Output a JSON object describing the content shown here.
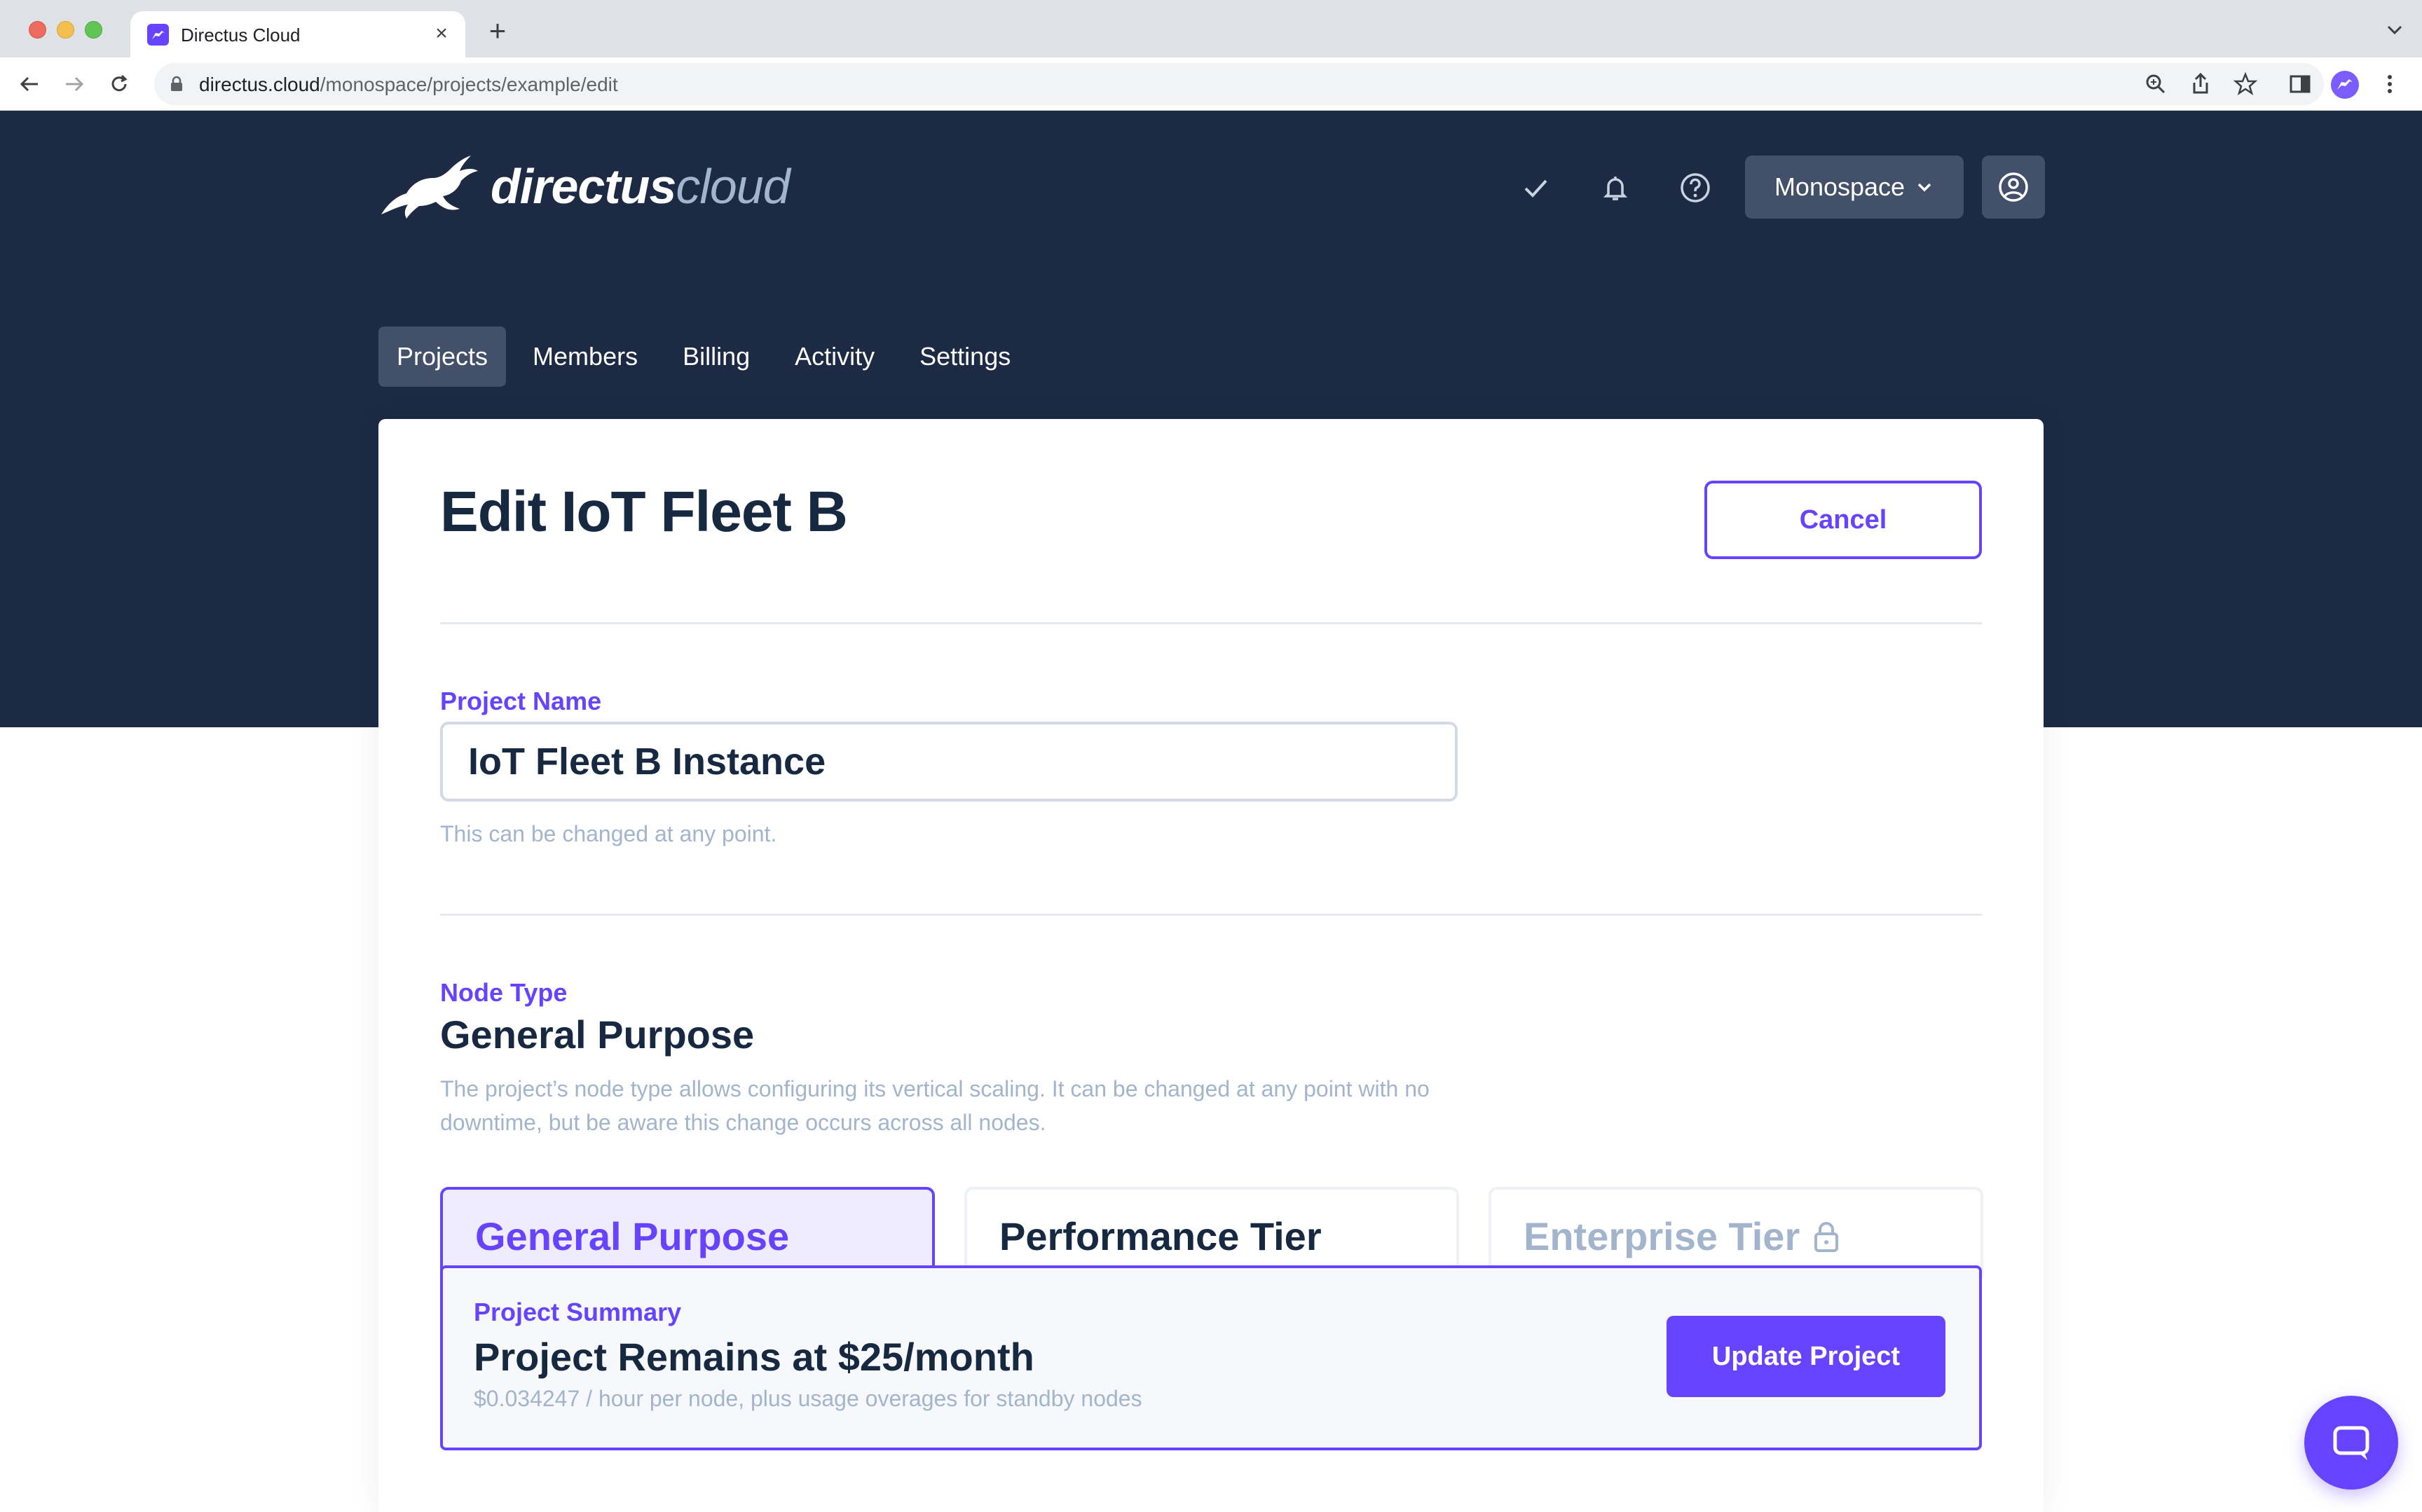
{
  "browser": {
    "tab_title": "Directus Cloud",
    "url_host": "directus.cloud",
    "url_path": "/monospace/projects/example/edit"
  },
  "header": {
    "logo_word": "directus",
    "logo_word_2": "cloud",
    "org_label": "Monospace"
  },
  "nav": {
    "tabs": [
      {
        "label": "Projects",
        "active": true
      },
      {
        "label": "Members",
        "active": false
      },
      {
        "label": "Billing",
        "active": false
      },
      {
        "label": "Activity",
        "active": false
      },
      {
        "label": "Settings",
        "active": false
      }
    ]
  },
  "page": {
    "title": "Edit IoT Fleet B",
    "cancel_label": "Cancel"
  },
  "project_name": {
    "label": "Project Name",
    "value": "IoT Fleet B Instance",
    "hint": "This can be changed at any point."
  },
  "node_type": {
    "label": "Node Type",
    "value": "General Purpose",
    "description": "The project’s node type allows configuring its vertical scaling. It can be changed at any point with no downtime, but be aware this change occurs across all nodes.",
    "tiers": [
      {
        "name": "General Purpose",
        "selected": true,
        "locked": false
      },
      {
        "name": "Performance Tier",
        "selected": false,
        "locked": false
      },
      {
        "name": "Enterprise Tier",
        "selected": false,
        "locked": true
      }
    ]
  },
  "summary": {
    "label": "Project Summary",
    "title": "Project Remains at $25/month",
    "subtitle": "$0.034247 / hour per node, plus usage overages for standby nodes",
    "update_label": "Update Project"
  },
  "colors": {
    "accent": "#6644ff",
    "header_bg": "#1c2a43",
    "text_dark": "#172940",
    "text_muted": "#a2b5cd"
  },
  "icons": [
    "check-icon",
    "bell-icon",
    "help-icon",
    "chevron-down-icon",
    "user-circle-icon",
    "lock-icon",
    "chat-icon"
  ]
}
